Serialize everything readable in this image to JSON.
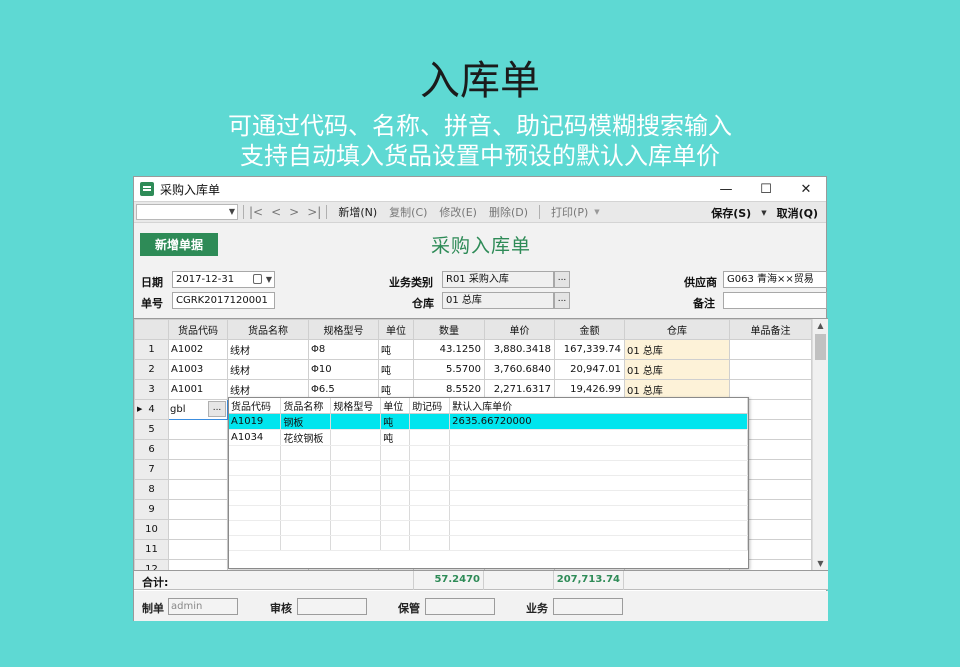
{
  "hero": {
    "title": "入库单",
    "subtitle1": "可通过代码、名称、拼音、助记码模糊搜索输入",
    "subtitle2": "支持自动填入货品设置中预设的默认入库单价"
  },
  "window": {
    "title": "采购入库单",
    "minimize": "—",
    "maximize": "☐",
    "close": "✕"
  },
  "toolbar": {
    "nav": [
      "|<",
      "<",
      ">",
      ">|"
    ],
    "new": "新增(N)",
    "copy": "复制(C)",
    "edit": "修改(E)",
    "delete": "删除(D)",
    "print": "打印(P)",
    "save": "保存(S)",
    "cancel": "取消(Q)"
  },
  "form": {
    "new_doc_button": "新增单据",
    "title": "采购入库单",
    "date_label": "日期",
    "date_value": "2017-12-31",
    "docno_label": "单号",
    "docno_value": "CGRK2017120001",
    "biztype_label": "业务类别",
    "biztype_value": "R01 采购入库",
    "warehouse_label": "仓库",
    "warehouse_value": "01 总库",
    "supplier_label": "供应商",
    "supplier_value": "G063 青海××贸易",
    "remark_label": "备注",
    "remark_value": ""
  },
  "grid": {
    "headers": [
      "",
      "货品代码",
      "货品名称",
      "规格型号",
      "单位",
      "数量",
      "单价",
      "金额",
      "仓库",
      "单品备注"
    ],
    "rows": [
      {
        "no": "1",
        "code": "A1002",
        "name": "线材",
        "spec": "Φ8",
        "unit": "吨",
        "qty": "43.1250",
        "price": "3,880.3418",
        "amount": "167,339.74",
        "warehouse": "01 总库",
        "note": ""
      },
      {
        "no": "2",
        "code": "A1003",
        "name": "线材",
        "spec": "Φ10",
        "unit": "吨",
        "qty": "5.5700",
        "price": "3,760.6840",
        "amount": "20,947.01",
        "warehouse": "01 总库",
        "note": ""
      },
      {
        "no": "3",
        "code": "A1001",
        "name": "线材",
        "spec": "Φ6.5",
        "unit": "吨",
        "qty": "8.5520",
        "price": "2,271.6317",
        "amount": "19,426.99",
        "warehouse": "01 总库",
        "note": ""
      },
      {
        "no": "4",
        "code": "gbl",
        "name": "",
        "spec": "",
        "unit": "",
        "qty": "",
        "price": "",
        "amount": "",
        "warehouse": "",
        "note": ""
      },
      {
        "no": "5"
      },
      {
        "no": "6"
      },
      {
        "no": "7"
      },
      {
        "no": "8"
      },
      {
        "no": "9"
      },
      {
        "no": "10"
      },
      {
        "no": "11"
      },
      {
        "no": "12"
      }
    ],
    "ellipsis": "..."
  },
  "popup": {
    "headers": [
      "货品代码",
      "货品名称",
      "规格型号",
      "单位",
      "助记码",
      "默认入库单价"
    ],
    "rows": [
      {
        "code": "A1019",
        "name": "钢板",
        "spec": "",
        "unit": "吨",
        "mnemonic": "",
        "price": "2635.66720000"
      },
      {
        "code": "A1034",
        "name": "花纹钢板",
        "spec": "",
        "unit": "吨",
        "mnemonic": "",
        "price": ""
      }
    ]
  },
  "totals": {
    "label": "合计:",
    "qty": "57.2470",
    "amount": "207,713.74"
  },
  "footer": {
    "maker_label": "制单",
    "maker_value": "admin",
    "reviewer_label": "审核",
    "keeper_label": "保管",
    "business_label": "业务"
  }
}
